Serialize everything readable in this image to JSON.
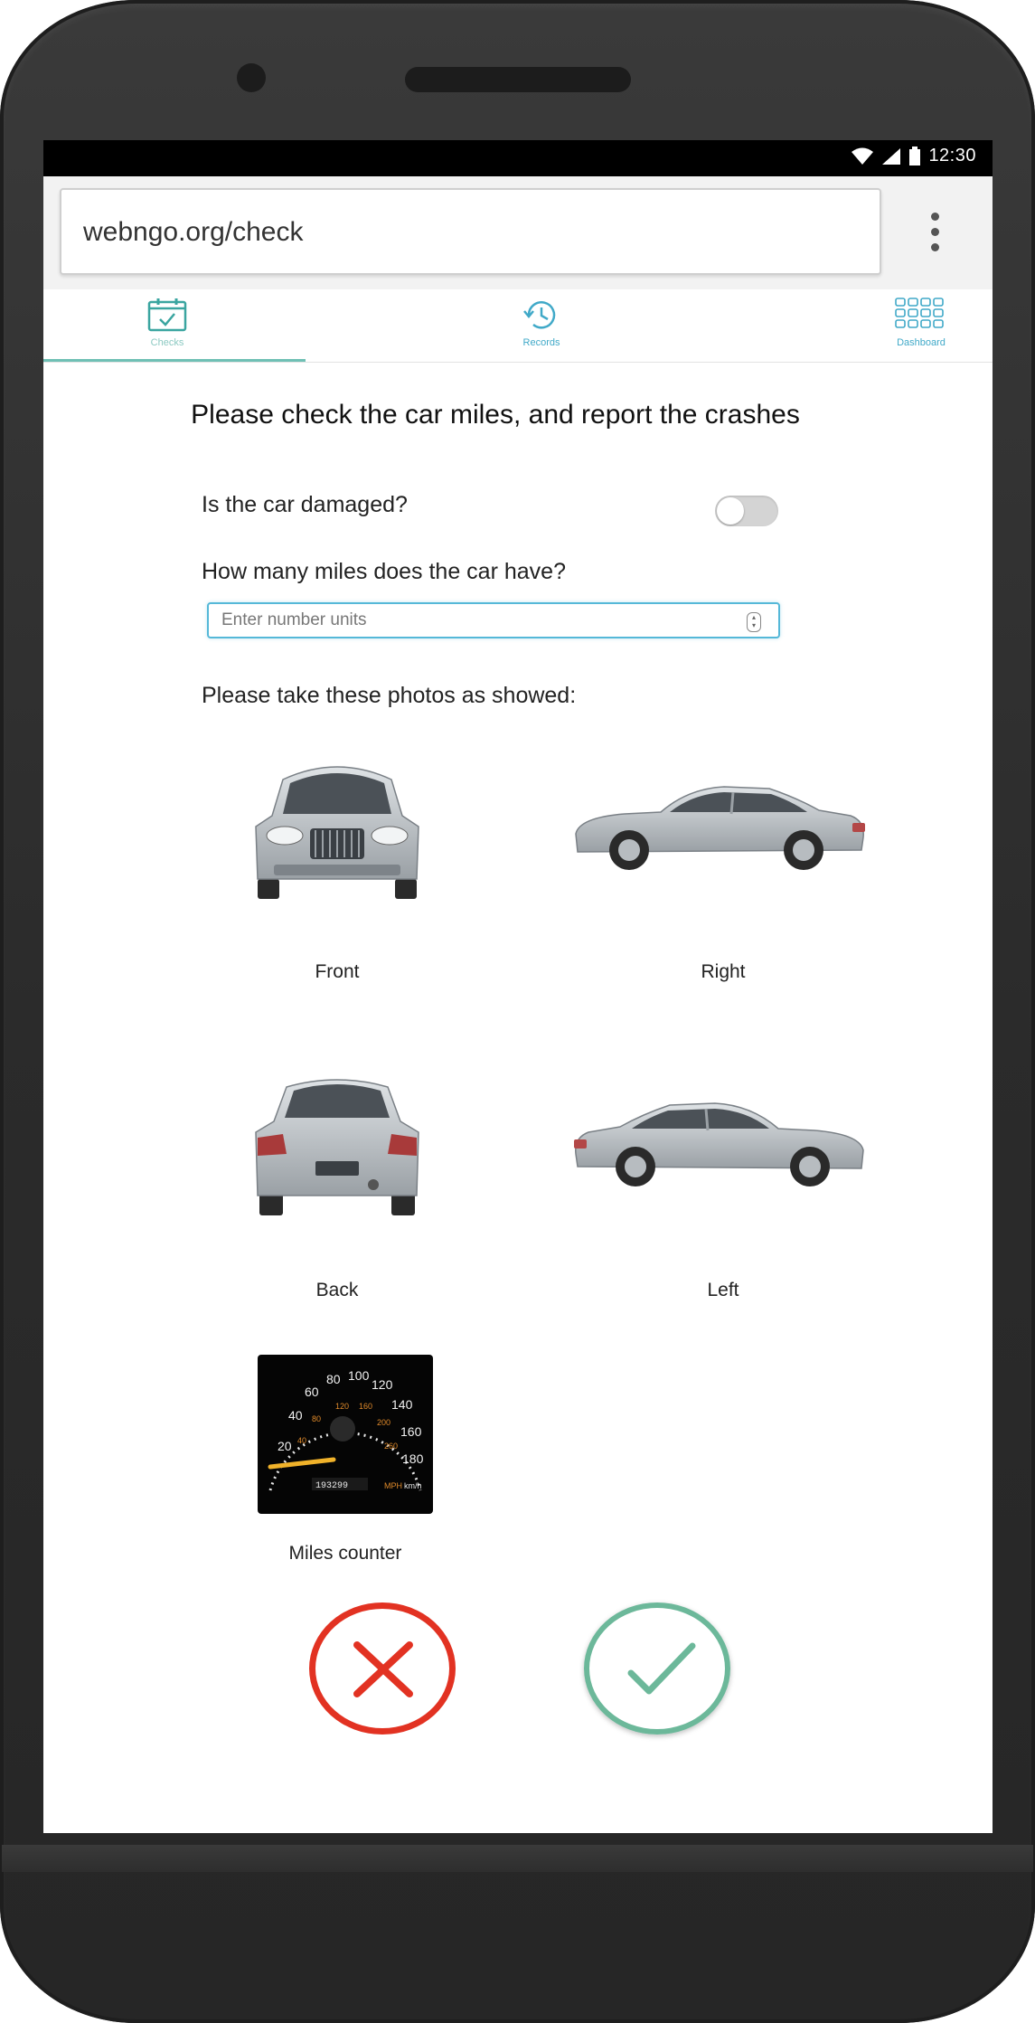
{
  "status_bar": {
    "time": "12:30"
  },
  "browser": {
    "url": "webngo.org/check"
  },
  "tabs": [
    {
      "label": "Checks",
      "active": true
    },
    {
      "label": "Records",
      "active": false
    },
    {
      "label": "Dashboard",
      "active": false
    }
  ],
  "form": {
    "title": "Please check the car miles, and report the crashes",
    "damaged_question": "Is the car damaged?",
    "damaged_toggle_on": false,
    "miles_question": "How many miles does the car have?",
    "miles_placeholder": "Enter number units",
    "photos_prompt": "Please take these photos as showed:",
    "photos": [
      {
        "label": "Front"
      },
      {
        "label": "Right"
      },
      {
        "label": "Back"
      },
      {
        "label": "Left"
      },
      {
        "label": "Miles counter",
        "odometer": "193299"
      }
    ]
  },
  "colors": {
    "accent": "#3aa5a0",
    "cancel": "#e23222",
    "confirm": "#6cb89a"
  }
}
